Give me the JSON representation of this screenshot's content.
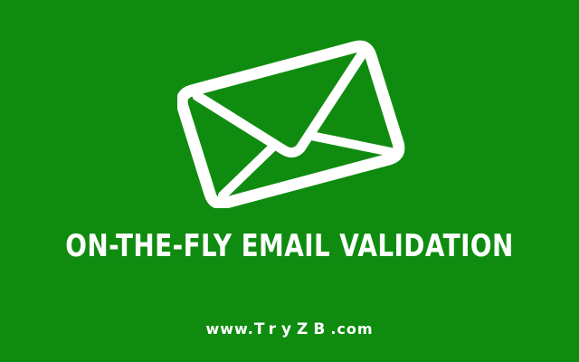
{
  "banner": {
    "headline": "ON-THE-FLY EMAIL VALIDATION",
    "website": {
      "prefix": "www.",
      "name": "TryZB",
      "suffix": ".com"
    },
    "icon": "envelope-icon",
    "colors": {
      "background": "#0f8c0f",
      "foreground": "#ffffff"
    }
  }
}
